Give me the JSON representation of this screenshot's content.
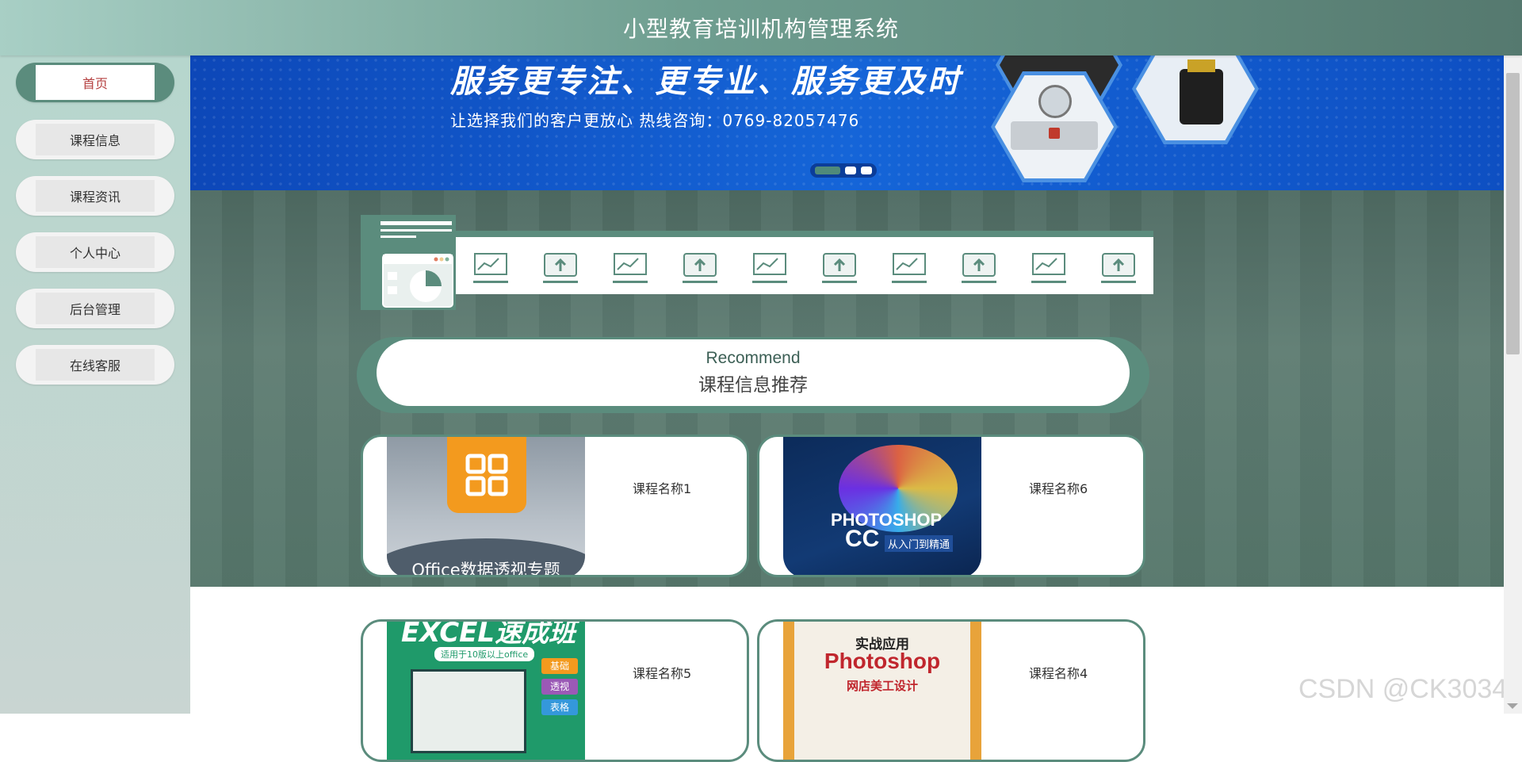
{
  "header": {
    "title": "小型教育培训机构管理系统"
  },
  "sidebar": {
    "items": [
      {
        "label": "首页",
        "active": true
      },
      {
        "label": "课程信息"
      },
      {
        "label": "课程资讯"
      },
      {
        "label": "个人中心"
      },
      {
        "label": "后台管理"
      },
      {
        "label": "在线客服"
      }
    ]
  },
  "banner": {
    "headline": "服务更专注、更专业、服务更及时",
    "subline": "让选择我们的客户更放心   热线咨询：0769-82057476",
    "slides": 3,
    "active_slide": 1
  },
  "recommend": {
    "title_en": "Recommend",
    "title_cn": "课程信息推荐"
  },
  "courses": [
    {
      "name": "课程名称1",
      "thumb_caption": "Office数据透视专题"
    },
    {
      "name": "课程名称6",
      "thumb_title": "PHOTOSHOP",
      "thumb_title_2": "CC",
      "thumb_sub": "从入门到精通"
    },
    {
      "name": "课程名称5",
      "thumb_caption": "EXCEL速成班",
      "thumb_note": "适用于10版以上office",
      "thumb_tags": [
        "基础",
        "透视",
        "表格"
      ]
    },
    {
      "name": "课程名称4",
      "thumb_title": "实战应用",
      "thumb_title_2": "Photoshop",
      "thumb_sub": "网店美工设计"
    }
  ],
  "watermark": "CSDN @CK3034",
  "colors": {
    "accent": "#5b8c7d",
    "banner_blue": "#1565d8",
    "active_text": "#b54040"
  }
}
